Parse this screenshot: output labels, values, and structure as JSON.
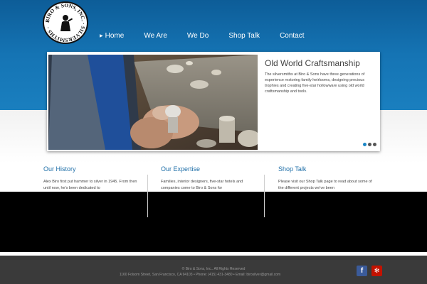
{
  "logo": {
    "text": "BIRO & SONS, INC. · SILVERSMITHS ·",
    "icon": "silversmith-seal-icon"
  },
  "nav": {
    "items": [
      {
        "label": "Home",
        "active": true
      },
      {
        "label": "We Are"
      },
      {
        "label": "We Do"
      },
      {
        "label": "Shop Talk"
      },
      {
        "label": "Contact"
      }
    ]
  },
  "slider": {
    "title": "Old World Craftsmanship",
    "body": "The silversmiths at Biro & Sons have three generations of experience restoring family heirlooms, designing precious trophies and creating five-star hollowware using old world craftsmanship and tools.",
    "dots": 3,
    "active_dot": 0
  },
  "columns": [
    {
      "title": "Our History",
      "text": "Alex Biro first put hammer to silver in 1945. From then until now, he's been dedicated to"
    },
    {
      "title": "Our Expertise",
      "text": "Families, interior designers, five-star hotels and companies come to Biro & Sons for"
    },
    {
      "title": "Shop Talk",
      "text": "Please visit our Shop Talk page to read about some of the different projects we've been"
    }
  ],
  "footer": {
    "copyright": "© Biro & Sons, Inc.. All Rights Reserved",
    "address": "1160 Folsom Street, San Francisco, CA 94103 • Phone: (415) 431-3480 • Email: birosilver@gmail.com",
    "social": [
      {
        "name": "facebook-icon",
        "glyph": "f"
      },
      {
        "name": "yelp-icon",
        "glyph": "✻"
      }
    ]
  },
  "colors": {
    "header_blue": "#1574b4",
    "heading_blue": "#1f6fa8",
    "accent_dot": "#1a86c6",
    "footer_bg": "#3a3a3a"
  }
}
